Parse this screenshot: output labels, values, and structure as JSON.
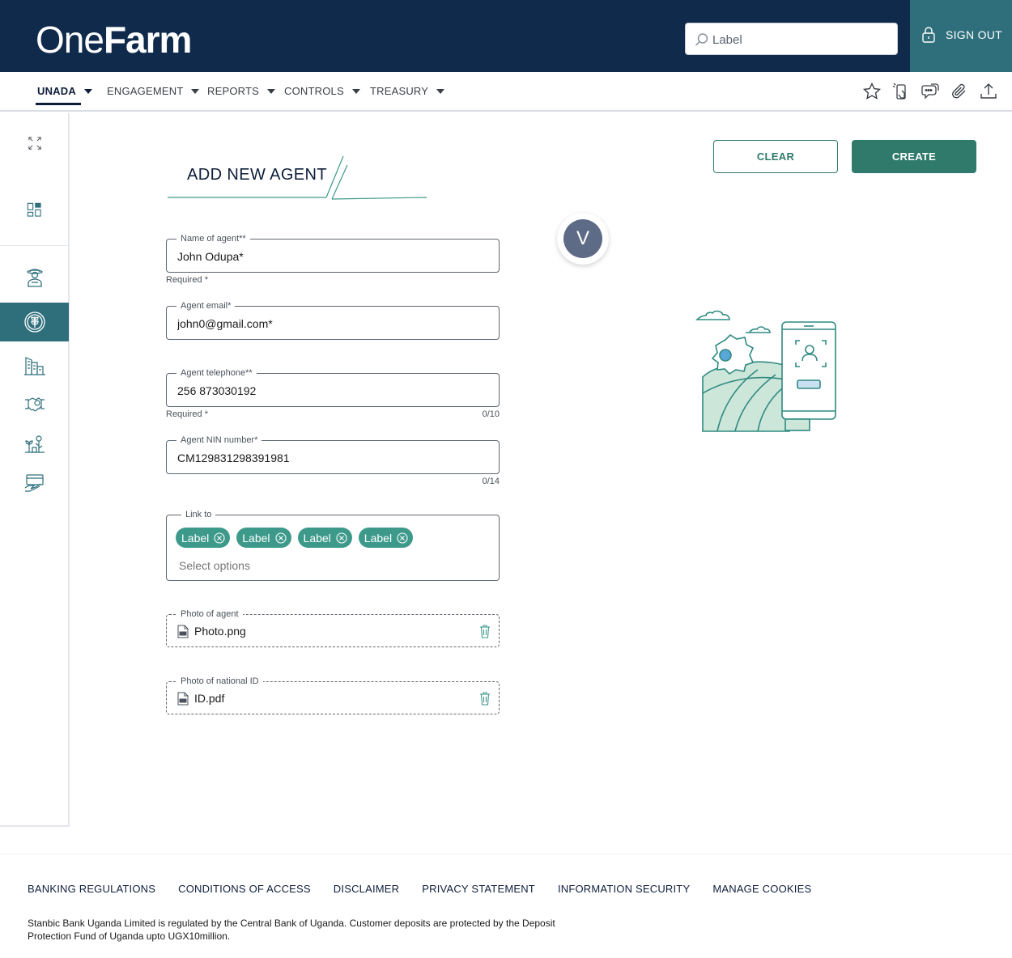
{
  "header": {
    "logo_one": "One",
    "logo_farm": "Farm",
    "search": {
      "value": "Label",
      "placeholder": "Label"
    },
    "sign_out_label": "SIGN OUT"
  },
  "nav": {
    "items": [
      {
        "label": "UNADA",
        "active": true
      },
      {
        "label": "ENGAGEMENT",
        "active": false
      },
      {
        "label": "REPORTS",
        "active": false
      },
      {
        "label": "CONTROLS",
        "active": false
      },
      {
        "label": "TREASURY",
        "active": false
      }
    ],
    "tools": [
      "star-icon",
      "touch-device-icon",
      "chat-icon",
      "attachment-icon",
      "upload-icon"
    ]
  },
  "sidebar": {
    "items": [
      "expand-icon",
      "dashboard-icon",
      "farmer-icon",
      "agent-plant-icon",
      "buildings-icon",
      "handshake-icon",
      "crops-icon",
      "payment-icon"
    ],
    "active": "agent-plant-icon"
  },
  "page": {
    "title": "ADD NEW AGENT",
    "clear_label": "CLEAR",
    "create_label": "CREATE",
    "avatar_initial": "V"
  },
  "form": {
    "name": {
      "label": "Name of agent**",
      "value": "John Odupa*",
      "helper": "Required *"
    },
    "email": {
      "label": "Agent email*",
      "value": "john0@gmail.com*"
    },
    "telephone": {
      "label": "Agent telephone**",
      "value": "256 873030192",
      "helper": "Required *",
      "count": "0/10"
    },
    "nin": {
      "label": "Agent NIN number*",
      "value": "CM129831298391981",
      "count": "0/14"
    },
    "link_to": {
      "label": "Link to",
      "chips": [
        "Label",
        "Label",
        "Label",
        "Label"
      ],
      "placeholder": "Select options"
    },
    "photo_agent": {
      "label": "Photo of agent",
      "file": "Photo.png"
    },
    "photo_id": {
      "label": "Photo of national ID",
      "file": "ID.pdf"
    }
  },
  "colors": {
    "header_bg": "#102a4c",
    "accent_teal": "#2f6f7c",
    "primary_green": "#2f7a6a",
    "chip_green": "#3d9a8b"
  },
  "footer": {
    "links": [
      "BANKING REGULATIONS",
      "CONDITIONS OF ACCESS",
      "DISCLAIMER",
      "PRIVACY STATEMENT",
      "INFORMATION SECURITY",
      "MANAGE COOKIES"
    ],
    "text": "Stanbic Bank Uganda Limited is regulated by the Central Bank of Uganda. Customer deposits are protected by the Deposit Protection Fund of Uganda upto UGX10million."
  }
}
